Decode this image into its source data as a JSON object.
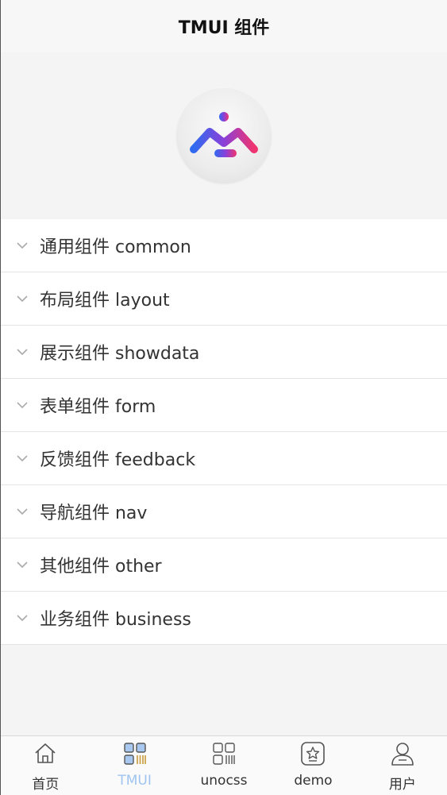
{
  "header": {
    "title": "TMUI 组件"
  },
  "list": [
    {
      "label": "通用组件 common"
    },
    {
      "label": "布局组件 layout"
    },
    {
      "label": "展示组件 showdata"
    },
    {
      "label": "表单组件 form"
    },
    {
      "label": "反馈组件 feedback"
    },
    {
      "label": "导航组件 nav"
    },
    {
      "label": "其他组件 other"
    },
    {
      "label": "业务组件 business"
    }
  ],
  "tabbar": {
    "tabs": [
      {
        "label": "首页",
        "icon": "home-icon"
      },
      {
        "label": "TMUI",
        "icon": "grid-icon",
        "active": true
      },
      {
        "label": "unocss",
        "icon": "grid-outline-icon"
      },
      {
        "label": "demo",
        "icon": "star-box-icon"
      },
      {
        "label": "用户",
        "icon": "user-icon"
      }
    ]
  },
  "colors": {
    "active_tab": "#9ec4ef",
    "logo_blue": "#2f6bf0",
    "logo_pink": "#f0346f"
  }
}
